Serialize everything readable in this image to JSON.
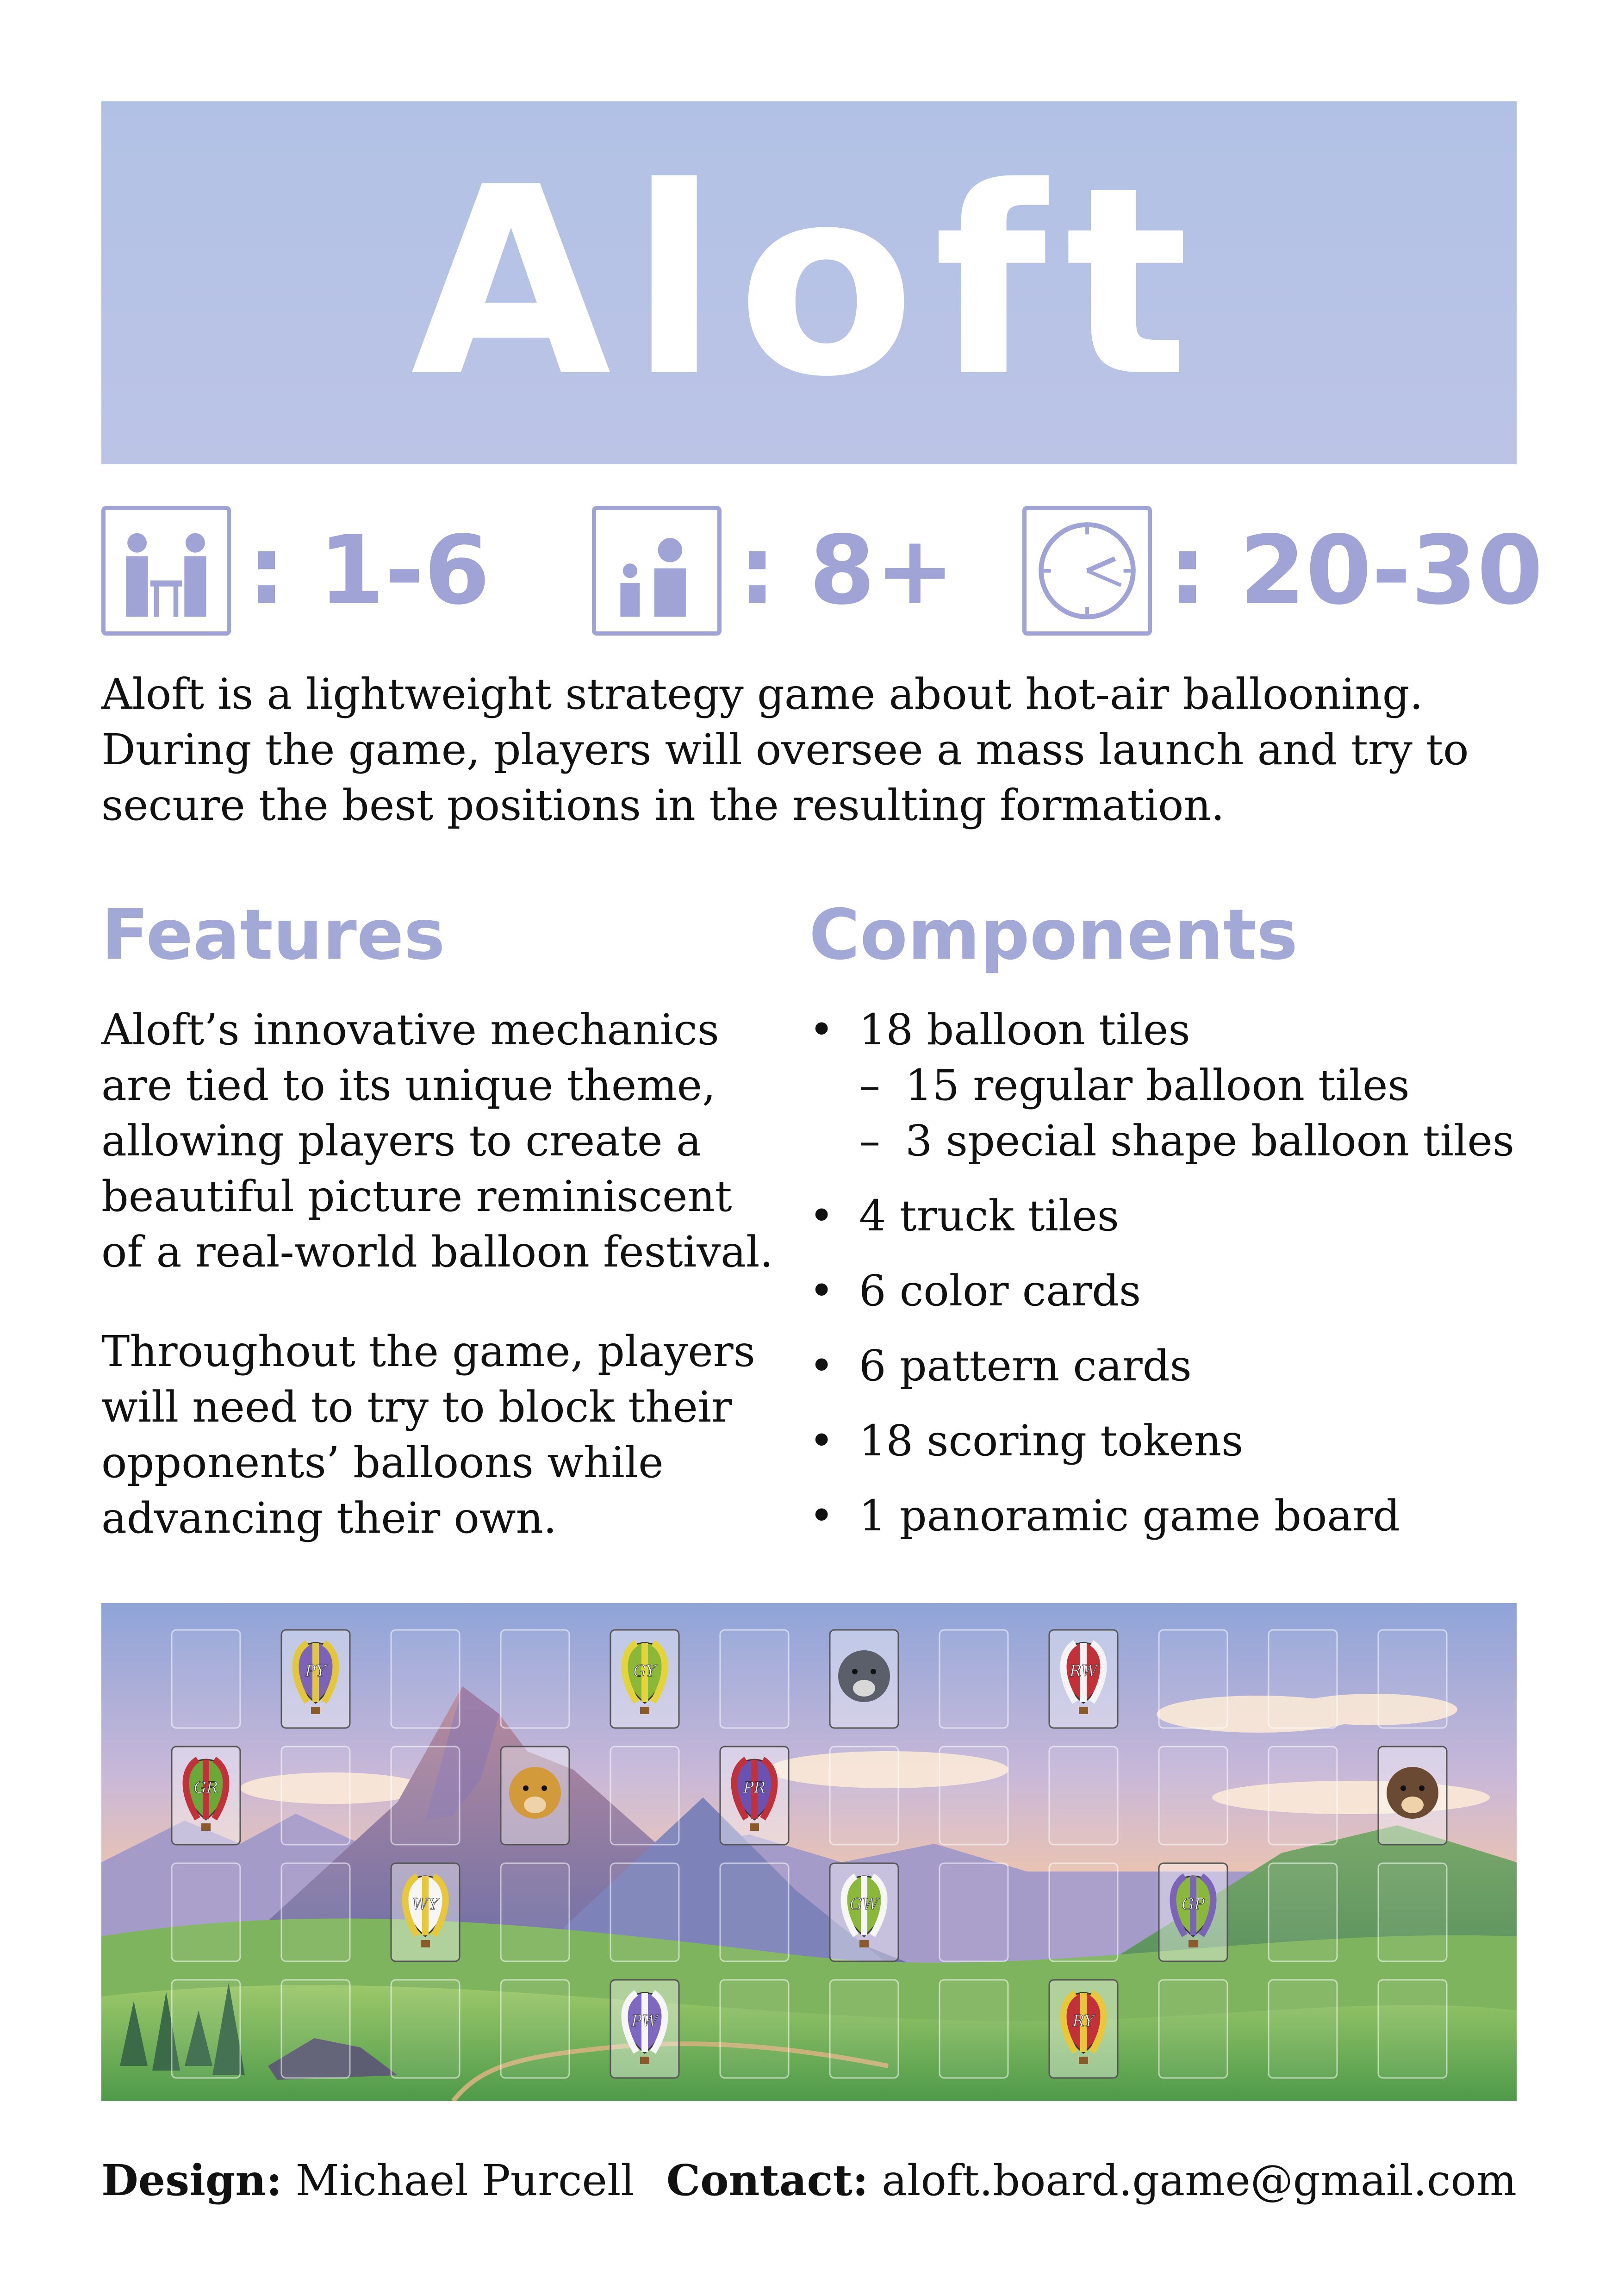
{
  "title": "Aloft",
  "stats": [
    {
      "icon": "player-table-icon",
      "value": ": 1-6"
    },
    {
      "icon": "age-people-icon",
      "value": ": 8+"
    },
    {
      "icon": "clock-icon",
      "value": ": 20-30"
    }
  ],
  "intro": [
    "Aloft is a lightweight strategy game about hot-air ballooning.",
    "During the game, players will oversee a mass launch and try to",
    "secure the best positions in the resulting formation."
  ],
  "features": {
    "heading": "Features",
    "paragraph1": [
      "Aloft’s innovative mechanics",
      "are tied to its unique theme,",
      "allowing players to create a",
      "beautiful picture reminiscent",
      "of a real-world balloon festival."
    ],
    "paragraph2": [
      "Throughout the game, players",
      "will need to try to block their",
      "opponents’ balloons while",
      "advancing their own."
    ]
  },
  "components": {
    "heading": "Components",
    "items": [
      {
        "text": "18 balloon tiles",
        "sub": [
          "15 regular balloon tiles",
          "3 special shape balloon tiles"
        ]
      },
      {
        "text": "4 truck tiles"
      },
      {
        "text": "6 color cards"
      },
      {
        "text": "6 pattern cards"
      },
      {
        "text": "18 scoring tokens"
      },
      {
        "text": "1 panoramic game board"
      }
    ]
  },
  "board": {
    "tiles": [
      {
        "row": 0,
        "col": 1,
        "kind": "balloon",
        "label": "PY",
        "colors": [
          "#7a63b8",
          "#e4c738"
        ]
      },
      {
        "row": 0,
        "col": 4,
        "kind": "balloon",
        "label": "GY",
        "colors": [
          "#8cb83a",
          "#e4d43a"
        ]
      },
      {
        "row": 0,
        "col": 6,
        "kind": "animal",
        "label": "wolf-icon"
      },
      {
        "row": 0,
        "col": 8,
        "kind": "balloon",
        "label": "RW",
        "colors": [
          "#c2303a",
          "#f4f4f4"
        ]
      },
      {
        "row": 1,
        "col": 0,
        "kind": "balloon",
        "label": "GR",
        "colors": [
          "#6aa83a",
          "#c2303a"
        ]
      },
      {
        "row": 1,
        "col": 3,
        "kind": "animal",
        "label": "lion-icon"
      },
      {
        "row": 1,
        "col": 5,
        "kind": "balloon",
        "label": "PR",
        "colors": [
          "#6a52b2",
          "#c2303a"
        ]
      },
      {
        "row": 1,
        "col": 11,
        "kind": "animal",
        "label": "monkey-icon"
      },
      {
        "row": 2,
        "col": 2,
        "kind": "balloon",
        "label": "WY",
        "colors": [
          "#f6f6f6",
          "#e8c838"
        ]
      },
      {
        "row": 2,
        "col": 6,
        "kind": "balloon",
        "label": "GW",
        "colors": [
          "#8ab83a",
          "#f6f6f6"
        ]
      },
      {
        "row": 2,
        "col": 9,
        "kind": "balloon",
        "label": "GP",
        "colors": [
          "#8ab83a",
          "#7a63b8"
        ]
      },
      {
        "row": 3,
        "col": 4,
        "kind": "balloon",
        "label": "PW",
        "colors": [
          "#7e68c0",
          "#f6f6f6"
        ]
      },
      {
        "row": 3,
        "col": 8,
        "kind": "balloon",
        "label": "RY",
        "colors": [
          "#c2303a",
          "#e8c838"
        ]
      }
    ]
  },
  "footer": {
    "design_label": "Design:",
    "design_value": "Michael Purcell",
    "contact_label": "Contact:",
    "contact_value": "aloft.board.game@gmail.com"
  }
}
